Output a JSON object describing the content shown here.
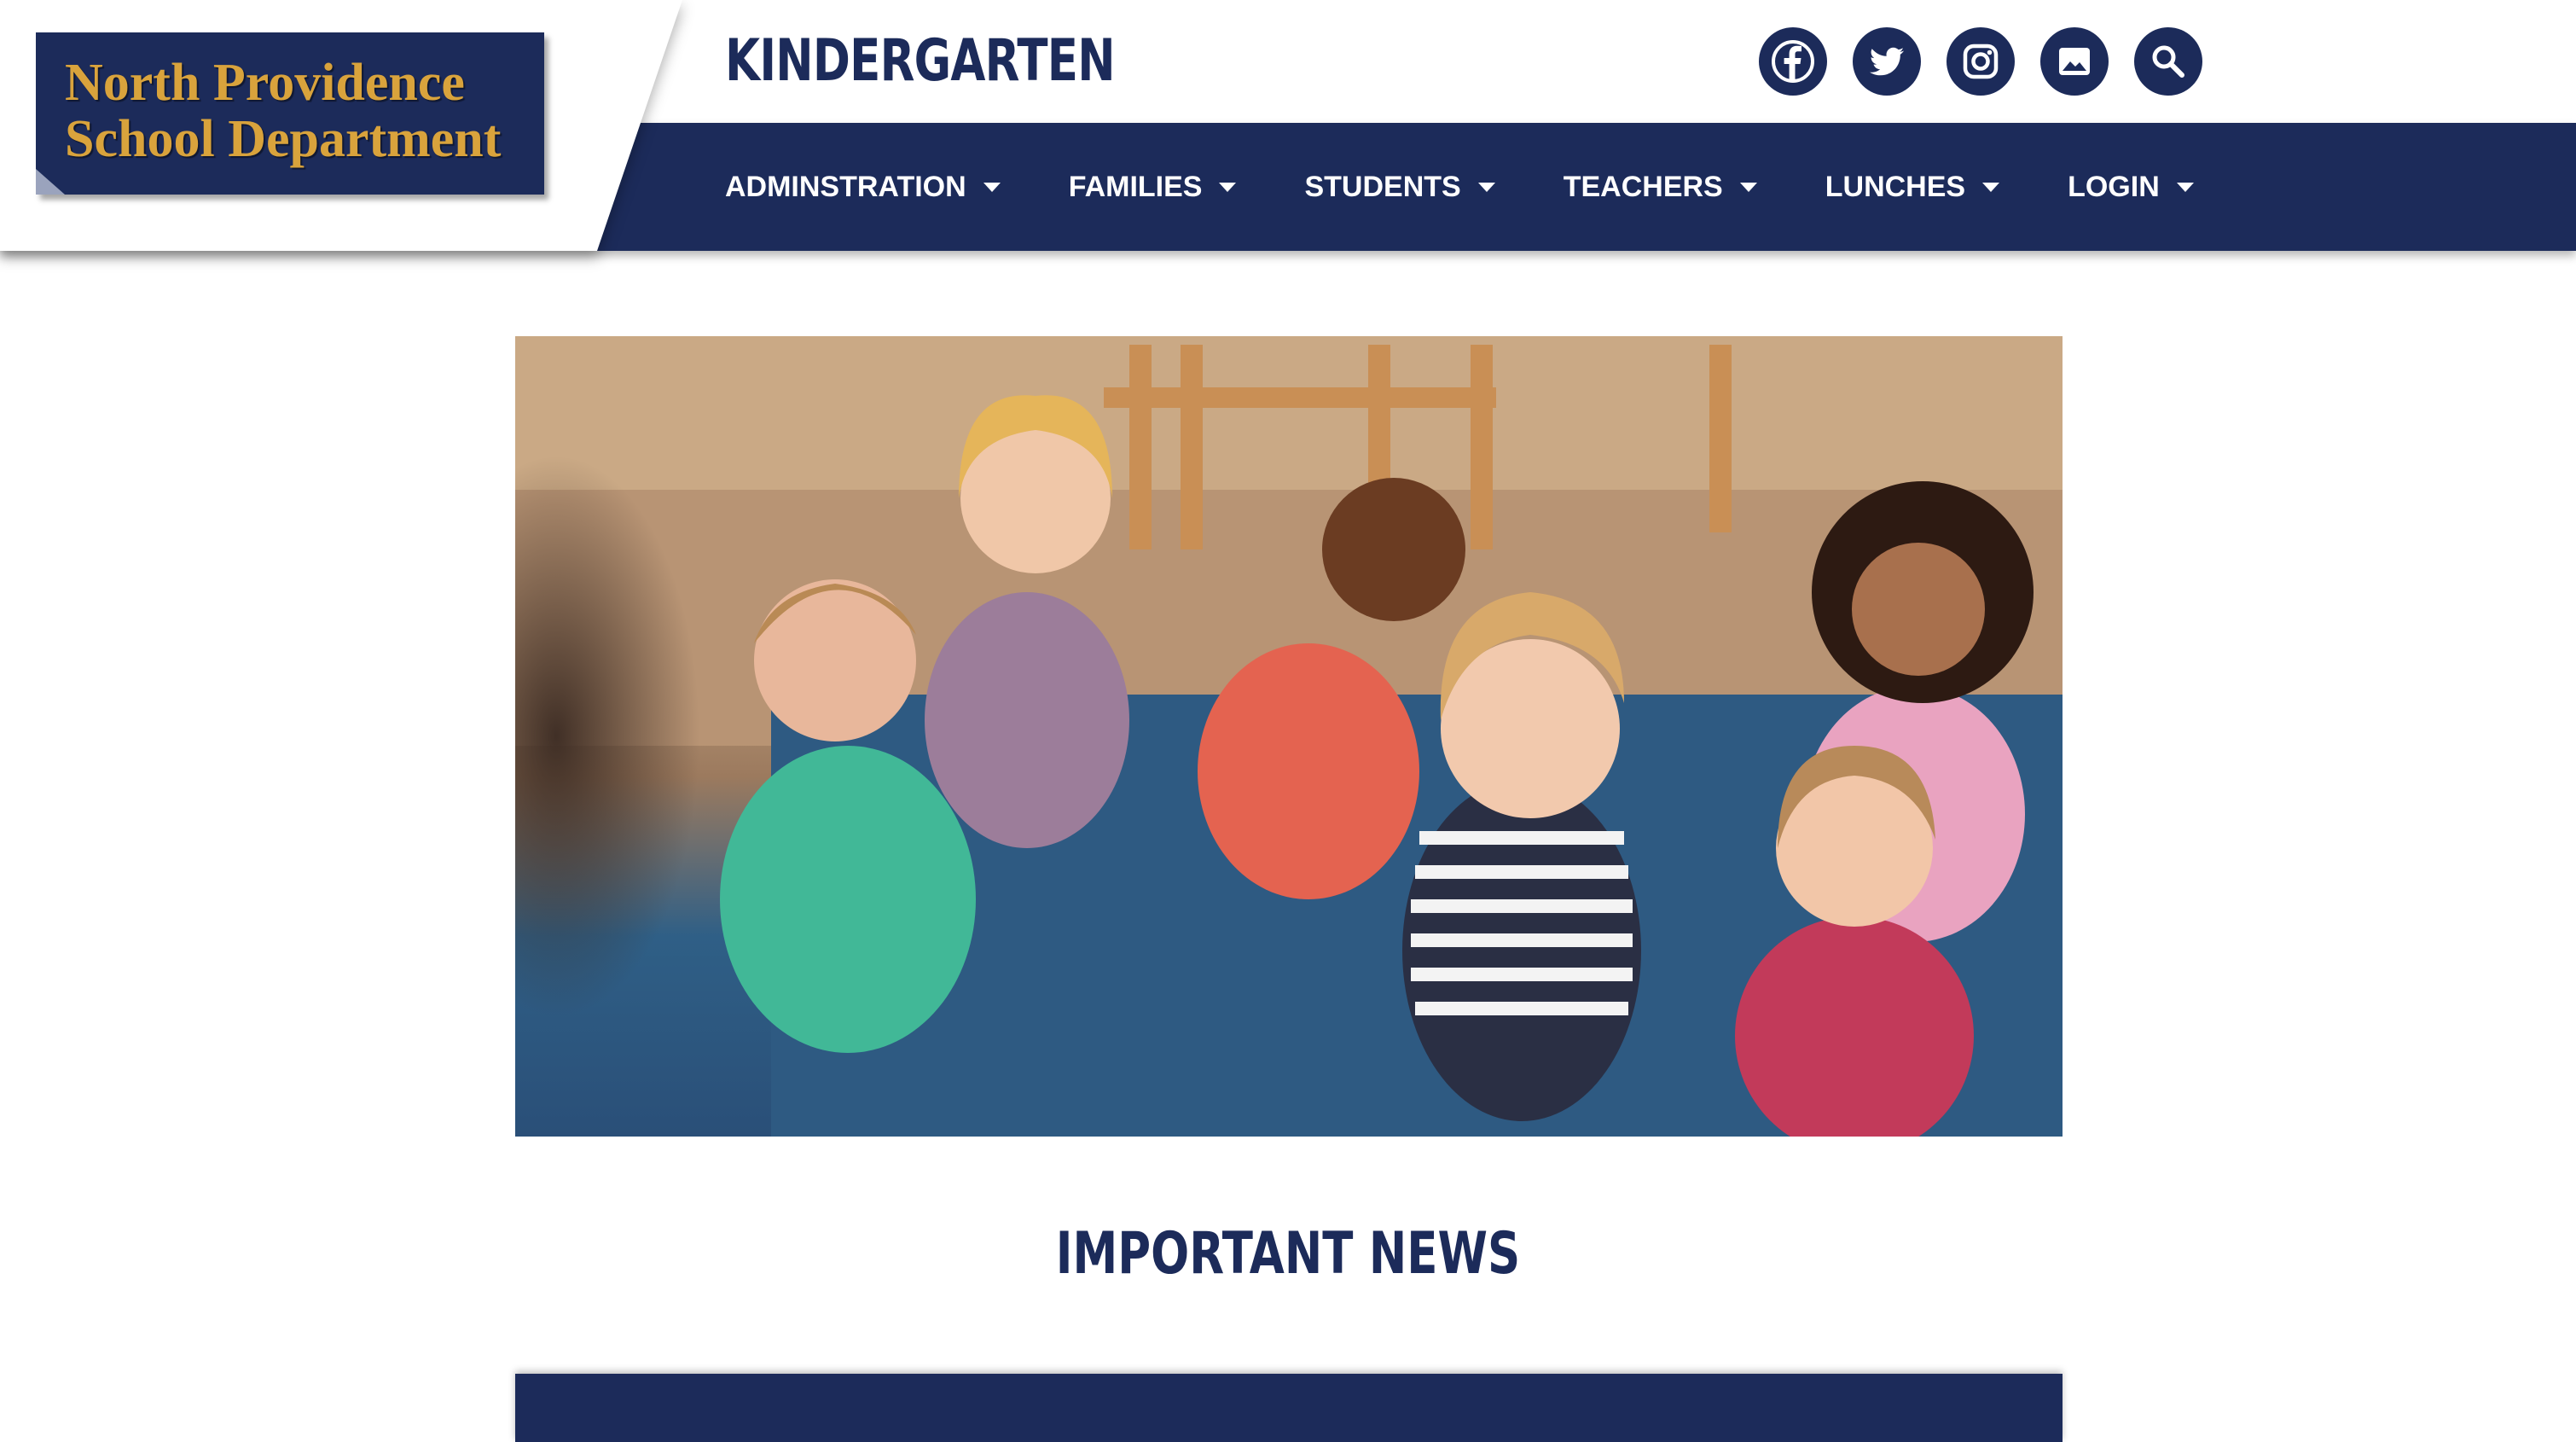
{
  "logo": {
    "line1": "North Providence",
    "line2": "School Department"
  },
  "page": {
    "title": "KINDERGARTEN"
  },
  "social": [
    {
      "icon": "facebook-icon"
    },
    {
      "icon": "twitter-icon"
    },
    {
      "icon": "instagram-icon"
    },
    {
      "icon": "gallery-icon"
    },
    {
      "icon": "search-icon"
    }
  ],
  "nav": {
    "items": [
      {
        "label": "ADMINSTRATION"
      },
      {
        "label": "FAMILIES"
      },
      {
        "label": "STUDENTS"
      },
      {
        "label": "TEACHERS"
      },
      {
        "label": "LUNCHES"
      },
      {
        "label": "LOGIN"
      }
    ]
  },
  "hero": {
    "image": "classroom-children-photo"
  },
  "news": {
    "heading": "IMPORTANT NEWS"
  },
  "colors": {
    "navy": "#1c2b5a",
    "gold": "#d9a33c",
    "white": "#ffffff"
  }
}
